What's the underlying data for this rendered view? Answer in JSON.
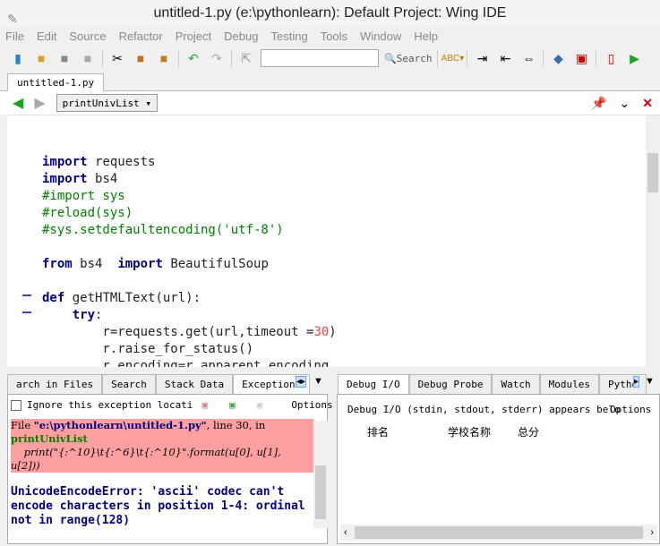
{
  "window": {
    "title": "untitled-1.py (e:\\pythonlearn): Default Project: Wing IDE"
  },
  "menu": [
    "File",
    "Edit",
    "Source",
    "Refactor",
    "Project",
    "Debug",
    "Testing",
    "Tools",
    "Window",
    "Help"
  ],
  "toolbar": {
    "search_value": "",
    "search_label": "Search"
  },
  "editor_tab": "untitled-1.py",
  "navigator": {
    "scope": "printUnivList"
  },
  "code": [
    [],
    [],
    [
      [
        "kw",
        "import"
      ],
      [
        "",
        "requests"
      ]
    ],
    [
      [
        "kw",
        "import"
      ],
      [
        "",
        "bs4"
      ]
    ],
    [
      [
        "cm",
        "#import sys"
      ]
    ],
    [
      [
        "cm",
        "#reload(sys)"
      ]
    ],
    [
      [
        "cm",
        "#sys.setdefaultencoding('utf-8')"
      ]
    ],
    [],
    [
      [
        "kw",
        "from"
      ],
      [
        "",
        "bs4  "
      ],
      [
        "kw",
        "import"
      ],
      [
        "",
        "BeautifulSoup"
      ]
    ],
    [],
    [
      [
        "kw",
        "def"
      ],
      [
        "",
        "getHTMLText(url):"
      ]
    ],
    [
      [
        "",
        "    "
      ],
      [
        "kw",
        "try"
      ],
      [
        "",
        ":"
      ]
    ],
    [
      [
        "",
        "        r=requests.get(url,timeout ="
      ],
      [
        "nm",
        "30"
      ],
      [
        "",
        ")"
      ]
    ],
    [
      [
        "",
        "        r.raise_for_status()"
      ]
    ],
    [
      [
        "",
        "        r.encoding=r.apparent_encoding"
      ]
    ]
  ],
  "left_panel": {
    "tabs": [
      "arch in Files",
      "Search",
      "Stack Data",
      "Exceptions"
    ],
    "active_tab": "Exceptions",
    "ignore_label": "Ignore this exception locati",
    "options": "Options",
    "trace_file_prefix": "File ",
    "trace_file": "\"e:\\pythonlearn\\untitled-1.py\"",
    "trace_line": ", line 30, in",
    "trace_func": "printUnivList",
    "trace_code": "    print(\"{:^10}\\t{:^6}\\t{:^10}\".format(u[0], u[1], u[2]))",
    "error": "UnicodeEncodeError: 'ascii' codec can't encode characters in position 1-4: ordinal not in range(128)"
  },
  "right_panel": {
    "tabs": [
      "Debug I/O",
      "Debug Probe",
      "Watch",
      "Modules",
      "Pytho"
    ],
    "active_tab": "Debug I/O",
    "info": "Debug I/O (stdin, stdout, stderr) appears belo",
    "options": "Options",
    "output": [
      "排名",
      "学校名称",
      "总分"
    ]
  }
}
